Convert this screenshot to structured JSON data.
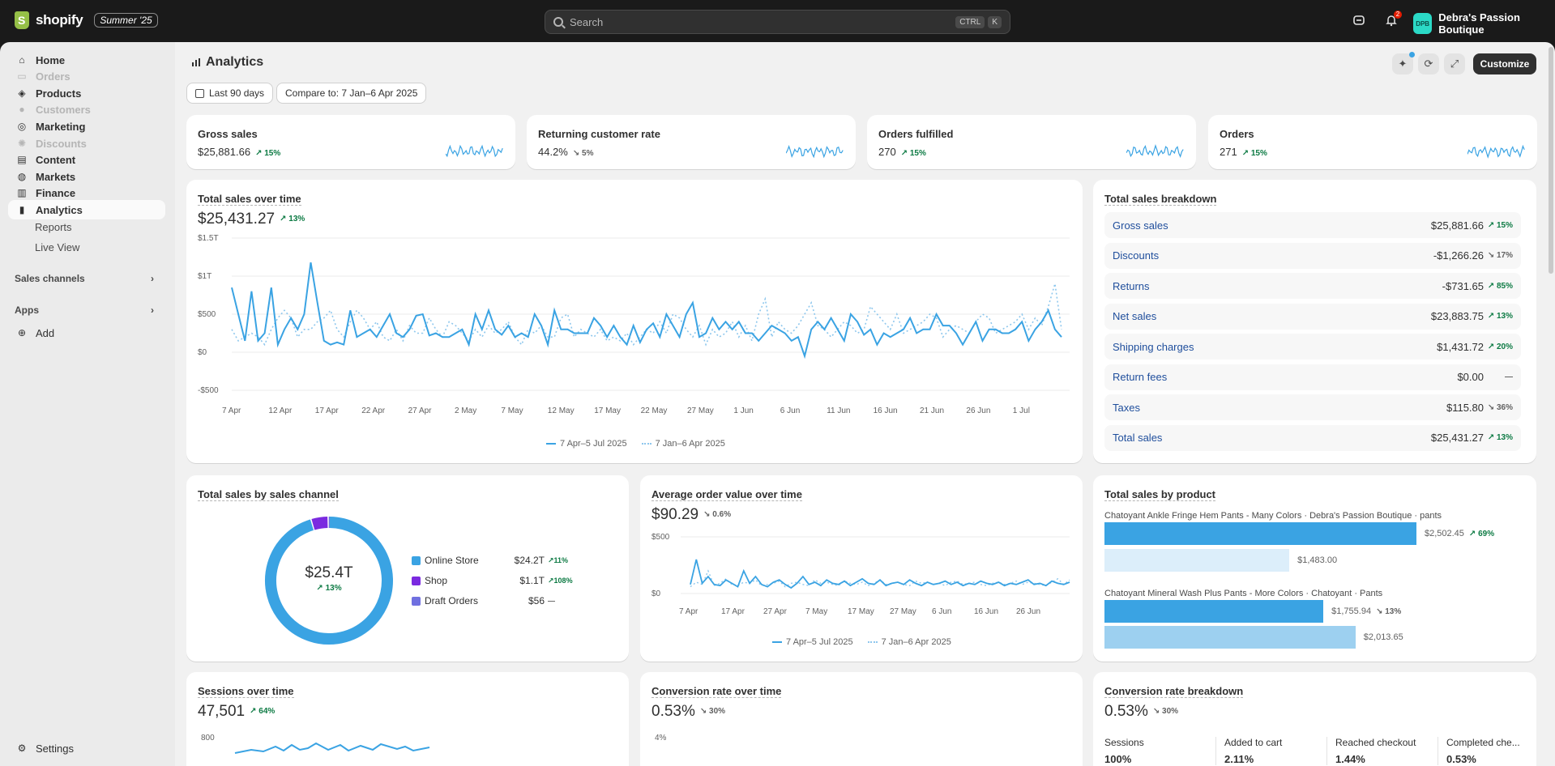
{
  "topbar": {
    "logo_text": "shopify",
    "edition": "Summer '25",
    "search_placeholder": "Search",
    "kbd_ctrl": "CTRL",
    "kbd_k": "K",
    "notification_count": "2",
    "store_initials": "DPB",
    "store_name": "Debra's Passion Boutique"
  },
  "sidebar": {
    "items": [
      {
        "label": "Home",
        "icon": "home-icon",
        "disabled": false
      },
      {
        "label": "Orders",
        "icon": "inbox-icon",
        "disabled": true
      },
      {
        "label": "Products",
        "icon": "tag-icon",
        "disabled": false
      },
      {
        "label": "Customers",
        "icon": "person-icon",
        "disabled": true
      },
      {
        "label": "Marketing",
        "icon": "target-icon",
        "disabled": false
      },
      {
        "label": "Discounts",
        "icon": "discount-icon",
        "disabled": true
      },
      {
        "label": "Content",
        "icon": "content-icon",
        "disabled": false
      },
      {
        "label": "Markets",
        "icon": "globe-icon",
        "disabled": false
      },
      {
        "label": "Finance",
        "icon": "bank-icon",
        "disabled": false
      },
      {
        "label": "Analytics",
        "icon": "chart-icon",
        "disabled": false
      }
    ],
    "sub_items": [
      "Reports",
      "Live View"
    ],
    "sales_channels": "Sales channels",
    "apps": "Apps",
    "add": "Add",
    "settings": "Settings"
  },
  "page": {
    "title": "Analytics",
    "date_range": "Last 90 days",
    "compare": "Compare to: 7 Jan–6 Apr 2025",
    "customize": "Customize"
  },
  "kpis": [
    {
      "title": "Gross sales",
      "value": "$25,881.66",
      "change": "15%",
      "trend": "up"
    },
    {
      "title": "Returning customer rate",
      "value": "44.2%",
      "change": "5%",
      "trend": "neutral"
    },
    {
      "title": "Orders fulfilled",
      "value": "270",
      "change": "15%",
      "trend": "up"
    },
    {
      "title": "Orders",
      "value": "271",
      "change": "15%",
      "trend": "up"
    }
  ],
  "total_sales_over_time": {
    "title": "Total sales over time",
    "value": "$25,431.27",
    "change": "13%",
    "legend_current": "7 Apr–5 Jul 2025",
    "legend_previous": "7 Jan–6 Apr 2025"
  },
  "chart_data": [
    {
      "type": "line",
      "title": "Total sales over time",
      "y_tick_labels": [
        "$1.5T",
        "$1T",
        "$500",
        "$0",
        "-$500"
      ],
      "y_tick_values": [
        1500,
        1000,
        500,
        0,
        -500
      ],
      "x_tick_labels": [
        "7 Apr",
        "12 Apr",
        "17 Apr",
        "22 Apr",
        "27 Apr",
        "2 May",
        "7 May",
        "12 May",
        "17 May",
        "22 May",
        "27 May",
        "1 Jun",
        "6 Jun",
        "11 Jun",
        "16 Jun",
        "21 Jun",
        "26 Jun",
        "1 Jul"
      ],
      "ylim": [
        -500,
        1500
      ],
      "series": [
        {
          "name": "7 Apr–5 Jul 2025",
          "values": [
            850,
            500,
            150,
            800,
            150,
            250,
            850,
            100,
            300,
            450,
            300,
            500,
            1180,
            650,
            150,
            100,
            130,
            100,
            550,
            200,
            250,
            300,
            200,
            350,
            500,
            250,
            200,
            300,
            480,
            500,
            220,
            250,
            200,
            200,
            250,
            300,
            100,
            500,
            300,
            550,
            300,
            230,
            350,
            200,
            250,
            200,
            500,
            350,
            100,
            550,
            300,
            300,
            250,
            250,
            250,
            450,
            350,
            200,
            350,
            200,
            100,
            350,
            130,
            300,
            380,
            200,
            500,
            350,
            200,
            500,
            650,
            200,
            250,
            450,
            300,
            400,
            300,
            400,
            250,
            250,
            150,
            250,
            350,
            300,
            250,
            150,
            200,
            -50,
            300,
            400,
            300,
            450,
            300,
            150,
            500,
            400,
            230,
            300,
            100,
            250,
            200,
            250,
            300,
            450,
            250,
            300,
            300,
            500,
            350,
            350,
            250,
            100,
            250,
            400,
            150,
            300,
            300,
            250,
            250,
            300,
            400,
            150,
            300,
            400,
            550,
            300,
            200
          ]
        },
        {
          "name": "7 Jan–6 Apr 2025",
          "values": [
            300,
            150,
            200,
            250,
            200,
            100,
            300,
            450,
            550,
            450,
            200,
            300,
            300,
            400,
            450,
            550,
            300,
            200,
            400,
            550,
            450,
            300,
            400,
            200,
            150,
            300,
            150,
            350,
            250,
            250,
            450,
            300,
            200,
            400,
            350,
            250,
            150,
            300,
            200,
            350,
            250,
            300,
            400,
            200,
            100,
            300,
            250,
            350,
            200,
            200,
            450,
            500,
            200,
            300,
            250,
            200,
            300,
            150,
            200,
            150,
            250,
            100,
            200,
            300,
            250,
            400,
            250,
            500,
            450,
            300,
            200,
            350,
            100,
            300,
            200,
            250,
            400,
            200,
            350,
            150,
            500,
            700,
            200,
            400,
            300,
            250,
            350,
            500,
            650,
            350,
            300,
            200,
            300,
            400,
            350,
            250,
            300,
            600,
            500,
            400,
            300,
            500,
            250,
            300,
            350,
            400,
            500,
            450,
            200,
            300,
            350,
            300,
            250,
            400,
            500,
            450,
            250,
            300,
            350,
            400,
            500,
            300,
            450,
            350,
            600,
            900,
            300
          ]
        }
      ]
    },
    {
      "type": "pie",
      "title": "Total sales by sales channel",
      "center_value": "$25.4T",
      "center_change": "13%",
      "categories": [
        "Online Store",
        "Shop",
        "Draft Orders"
      ],
      "values": [
        24200,
        1100,
        56
      ],
      "display_values": [
        "$24.2T",
        "$1.1T",
        "$56"
      ],
      "changes": [
        "11%",
        "108%",
        "—"
      ],
      "colors": [
        "#3aa3e3",
        "#7b2ae0",
        "#7070e0"
      ]
    },
    {
      "type": "line",
      "title": "Average order value over time",
      "y_tick_labels": [
        "$500",
        "$0"
      ],
      "y_tick_values": [
        500,
        0
      ],
      "x_tick_labels": [
        "7 Apr",
        "17 Apr",
        "27 Apr",
        "7 May",
        "17 May",
        "27 May",
        "6 Jun",
        "16 Jun",
        "26 Jun"
      ],
      "ylim": [
        0,
        500
      ],
      "series": [
        {
          "name": "7 Apr–5 Jul 2025",
          "values": [
            80,
            300,
            90,
            150,
            80,
            70,
            120,
            90,
            60,
            200,
            90,
            150,
            80,
            60,
            100,
            120,
            80,
            50,
            90,
            150,
            80,
            100,
            70,
            120,
            90,
            80,
            110,
            70,
            100,
            130,
            90,
            80,
            120,
            70,
            90,
            100,
            80,
            120,
            90,
            70,
            100,
            80,
            90,
            110,
            80,
            100,
            70,
            90,
            80,
            110,
            90,
            80,
            100,
            70,
            90,
            80,
            100,
            120,
            80,
            90,
            70,
            110,
            90,
            80,
            100
          ]
        },
        {
          "name": "7 Jan–6 Apr 2025",
          "values": [
            60,
            100,
            80,
            200,
            70,
            90,
            130,
            80,
            70,
            100,
            90,
            120,
            70,
            80,
            90,
            110,
            60,
            90,
            100,
            80,
            70,
            120,
            90,
            100,
            80,
            70,
            110,
            90,
            80,
            100,
            70,
            90,
            120,
            80,
            90,
            100,
            80,
            70,
            110,
            90,
            100,
            80,
            90,
            70,
            100,
            110,
            80,
            90,
            100,
            80,
            70,
            90,
            100,
            80,
            90,
            110,
            80,
            100,
            90,
            80,
            70,
            100,
            130,
            80,
            120
          ]
        }
      ]
    },
    {
      "type": "bar",
      "title": "Total sales by product",
      "categories": [
        "Chatoyant Ankle Fringe Hem Pants - Many Colors · Debra's Passion Boutique · pants",
        "Chatoyant Mineral Wash Plus Pants - More Colors · Chatoyant · Pants"
      ],
      "series": [
        {
          "name": "7 Apr–5 Jul 2025",
          "values": [
            2502.45,
            1755.94
          ]
        },
        {
          "name": "7 Jan–6 Apr 2025",
          "values": [
            1483.0,
            2013.65
          ]
        }
      ],
      "display_current": [
        "$2,502.45",
        "$1,755.94"
      ],
      "display_previous": [
        "$1,483.00",
        "$2,013.65"
      ],
      "changes": [
        "69%",
        "13%"
      ],
      "change_trends": [
        "up",
        "neutral"
      ],
      "xlim": [
        0,
        2600
      ]
    }
  ],
  "breakdown": {
    "title": "Total sales breakdown",
    "rows": [
      {
        "label": "Gross sales",
        "value": "$25,881.66",
        "change": "15%",
        "trend": "up"
      },
      {
        "label": "Discounts",
        "value": "-$1,266.26",
        "change": "17%",
        "trend": "neutral"
      },
      {
        "label": "Returns",
        "value": "-$731.65",
        "change": "85%",
        "trend": "up"
      },
      {
        "label": "Net sales",
        "value": "$23,883.75",
        "change": "13%",
        "trend": "up"
      },
      {
        "label": "Shipping charges",
        "value": "$1,431.72",
        "change": "20%",
        "trend": "up"
      },
      {
        "label": "Return fees",
        "value": "$0.00",
        "change": "—",
        "trend": "neutral"
      },
      {
        "label": "Taxes",
        "value": "$115.80",
        "change": "36%",
        "trend": "neutral"
      },
      {
        "label": "Total sales",
        "value": "$25,431.27",
        "change": "13%",
        "trend": "up"
      }
    ]
  },
  "aov": {
    "title": "Average order value over time",
    "value": "$90.29",
    "change": "0.6%",
    "legend_current": "7 Apr–5 Jul 2025",
    "legend_previous": "7 Jan–6 Apr 2025"
  },
  "sessions": {
    "title": "Sessions over time",
    "value": "47,501",
    "change": "64%",
    "y_top": "800"
  },
  "conversion": {
    "title": "Conversion rate over time",
    "value": "0.53%",
    "change": "30%",
    "y_top": "4%"
  },
  "conversion_breakdown": {
    "title": "Conversion rate breakdown",
    "value": "0.53%",
    "change": "30%",
    "columns": [
      {
        "label": "Sessions",
        "value": "100%"
      },
      {
        "label": "Added to cart",
        "value": "2.11%"
      },
      {
        "label": "Reached checkout",
        "value": "1.44%"
      },
      {
        "label": "Completed che...",
        "value": "0.53%"
      }
    ]
  },
  "colors": {
    "accent": "#3aa3e3",
    "previous": "#8ec7ed",
    "positive": "#0c7a43"
  }
}
